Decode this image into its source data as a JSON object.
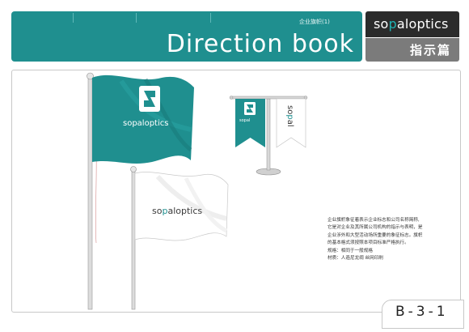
{
  "header": {
    "subtitle": "企业旗帜(1)",
    "title": "Direction book"
  },
  "brand": {
    "logo_a": "so",
    "logo_b": "p",
    "logo_c": "al",
    "logo_d": "optics",
    "section_label": "指示篇"
  },
  "description": [
    "企业旗帜象征着表示企业标志和公司名称简称,",
    "它是对企业及其所属公司机构的指示与表明，是",
    "企业涉外和大型活动场所重要的象征标志。旗帜",
    "的基本格式须按照本项目标准严格执行。",
    "规格：相同于一般规格",
    "材质：人造尼龙绸 丝网印刷"
  ],
  "page_code": "B-3-1",
  "colors": {
    "teal": "#1f8f8f",
    "dark": "#2b2b2b",
    "grey": "#7b7b7b"
  }
}
